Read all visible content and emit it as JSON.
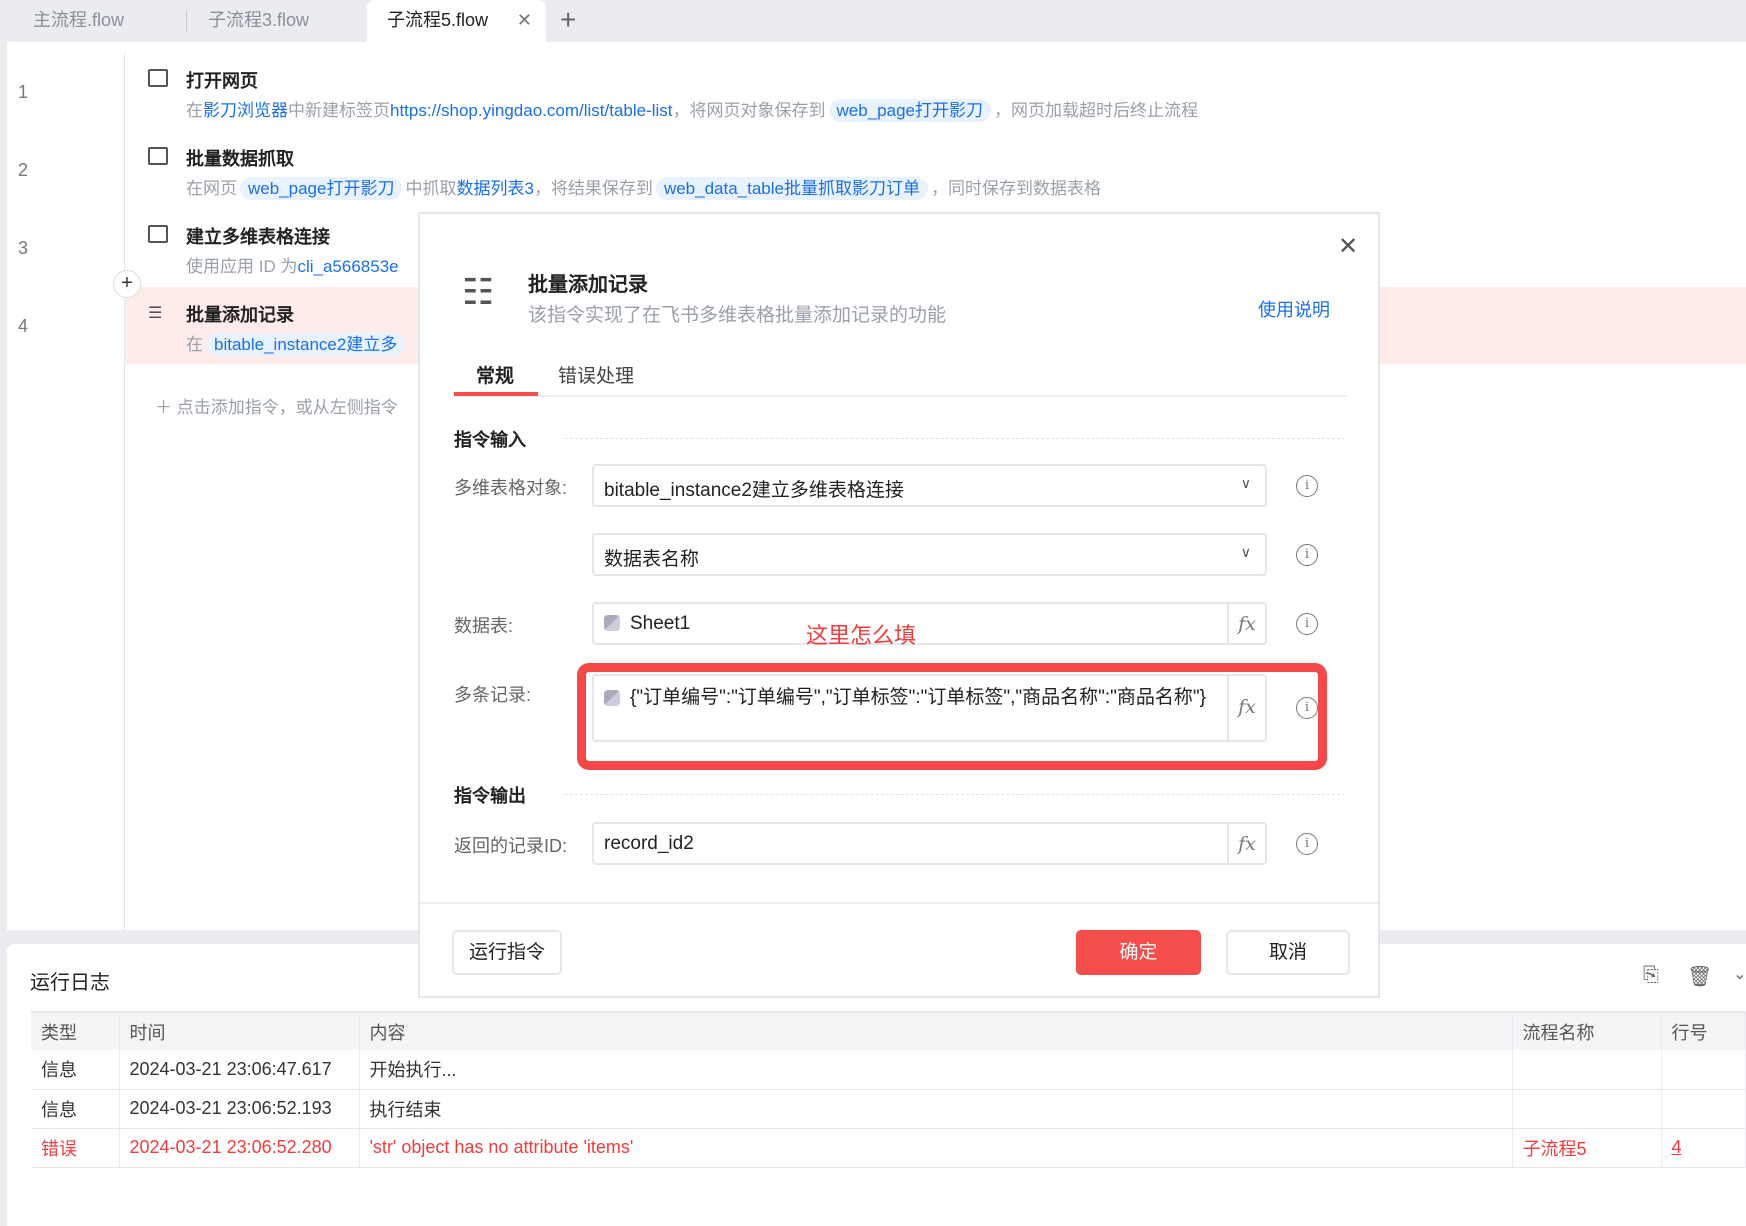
{
  "tabs": [
    {
      "label": "主流程.flow"
    },
    {
      "label": "子流程3.flow"
    },
    {
      "label": "子流程5.flow",
      "active": true
    }
  ],
  "steps": [
    {
      "line": "1",
      "title": "打开网页",
      "desc": {
        "p1": "在",
        "browser": "影刀浏览器",
        "p2": "中新建标签页",
        "url": "https://shop.yingdao.com/list/table-list",
        "p3": "，将网页对象保存到",
        "var": "web_page打开影刀",
        "p4": "，网页加载超时后终止流程"
      }
    },
    {
      "line": "2",
      "title": "批量数据抓取",
      "desc": {
        "p1": "在网页",
        "var1": "web_page打开影刀",
        "p2": "中抓取",
        "target": "数据列表3",
        "p3": "，将结果保存到",
        "var2": "web_data_table批量抓取影刀订单",
        "p4": "，同时保存到数据表格"
      }
    },
    {
      "line": "3",
      "title": "建立多维表格连接",
      "desc": {
        "p1": "使用应用 ID 为",
        "app": "cli_a566853e"
      }
    },
    {
      "line": "4",
      "title": "批量添加记录",
      "desc": {
        "p1": "在",
        "var": "bitable_instance2建立多"
      }
    }
  ],
  "add_hint": "点击添加指令，或从左侧指令",
  "dialog": {
    "title": "批量添加记录",
    "subtitle": "该指令实现了在飞书多维表格批量添加记录的功能",
    "help_link": "使用说明",
    "tabs": [
      "常规",
      "错误处理"
    ],
    "input_section": "指令输入",
    "output_section": "指令输出",
    "fields": {
      "bitable_label": "多维表格对象:",
      "bitable_value": "bitable_instance2建立多维表格连接",
      "table_mode_value": "数据表名称",
      "table_label": "数据表:",
      "table_value": "Sheet1",
      "records_label": "多条记录:",
      "records_value": "{\"订单编号\":\"订单编号\",\"订单标签\":\"订单标签\",\"商品名称\":\"商品名称\"}",
      "output_label": "返回的记录ID:",
      "output_value": "record_id2"
    },
    "annotation": "这里怎么填",
    "run_button": "运行指令",
    "ok_button": "确定",
    "cancel_button": "取消",
    "fx": "fx"
  },
  "log": {
    "title": "运行日志",
    "columns": [
      "类型",
      "时间",
      "内容",
      "流程名称",
      "行号"
    ],
    "rows": [
      {
        "type": "信息",
        "time": "2024-03-21 23:06:47.617",
        "content": "开始执行...",
        "flow": "",
        "line": ""
      },
      {
        "type": "信息",
        "time": "2024-03-21 23:06:52.193",
        "content": "执行结束",
        "flow": "",
        "line": ""
      },
      {
        "type": "错误",
        "time": "2024-03-21 23:06:52.280",
        "content": "'str' object has no attribute 'items'",
        "flow": "子流程5",
        "line": "4"
      }
    ]
  },
  "colors": {
    "accent": "#f54c4c",
    "link": "#1a6fe8"
  }
}
